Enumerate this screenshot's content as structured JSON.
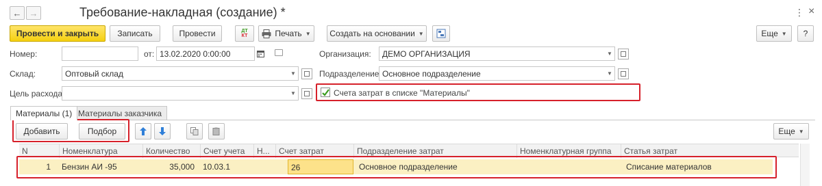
{
  "window": {
    "title": "Требование-накладная (создание) *",
    "back_icon": "←",
    "forward_icon": "→",
    "more_icon": "⋮",
    "close_icon": "×"
  },
  "toolbar": {
    "post_close": "Провести и закрыть",
    "save": "Записать",
    "post": "Провести",
    "dtkt": "ДтКт",
    "print": "Печать",
    "create_based": "Создать на основании",
    "more": "Еще",
    "help": "?"
  },
  "form": {
    "number_label": "Номер:",
    "number_value": "",
    "date_label": "от:",
    "date_value": "13.02.2020  0:00:00",
    "org_label": "Организация:",
    "org_value": "ДЕМО ОРГАНИЗАЦИЯ",
    "warehouse_label": "Склад:",
    "warehouse_value": "Оптовый склад",
    "department_label": "Подразделение:",
    "department_value": "Основное подразделение",
    "purpose_label": "Цель расхода:",
    "purpose_value": "",
    "accounts_checkbox_label": "Счета затрат в списке \"Материалы\"",
    "accounts_checkbox_checked": true
  },
  "tabs": [
    {
      "label": "Материалы (1)",
      "active": true
    },
    {
      "label": "Материалы заказчика",
      "active": false
    }
  ],
  "table_toolbar": {
    "add": "Добавить",
    "select": "Подбор",
    "more": "Еще"
  },
  "table": {
    "columns": [
      "N",
      "Номенклатура",
      "Количество",
      "Счет учета",
      "Н...",
      "Счет затрат",
      "Подразделение затрат",
      "Номенклатурная группа",
      "Статья затрат"
    ],
    "rows": [
      {
        "n": "1",
        "item": "Бензин АИ -95",
        "qty": "35,000",
        "account": "10.03.1",
        "n_col": "",
        "cost_account": "26",
        "cost_dept": "Основное подразделение",
        "nom_group": "",
        "cost_item": "Списание материалов"
      }
    ]
  },
  "colors": {
    "primary_button": "#f5d010",
    "annotation_red": "#d6202a",
    "selected_row": "#fbf0c3",
    "checkbox_green": "#3a9a1e",
    "arrow_blue": "#2f7fd8"
  }
}
